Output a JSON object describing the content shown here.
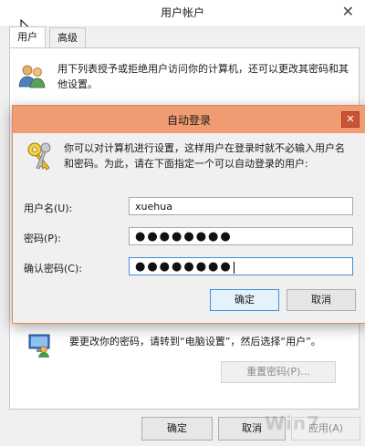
{
  "parent": {
    "title": "用户帐户",
    "tabs": [
      {
        "label": "用户",
        "active": true
      },
      {
        "label": "高级",
        "active": false
      }
    ],
    "description": "用下列表授予或拒绝用户访问你的计算机，还可以更改其密码和其他设置。",
    "password_hint": "要更改你的密码，请转到“电脑设置”，然后选择“用户”。",
    "reset_password_button": "重置密码(P)...",
    "buttons": {
      "ok": "确定",
      "cancel": "取消",
      "apply": "应用(A)"
    }
  },
  "dialog": {
    "title": "自动登录",
    "close_label": "✕",
    "description": "你可以对计算机进行设置，这样用户在登录时就不必输入用户名和密码。为此，请在下面指定一个可以自动登录的用户:",
    "fields": {
      "username": {
        "label": "用户名(U):",
        "value": "xuehua"
      },
      "password": {
        "label": "密码(P):",
        "value": "●●●●●●●●"
      },
      "confirm": {
        "label": "确认密码(C):",
        "value": "●●●●●●●●"
      }
    },
    "buttons": {
      "ok": "确定",
      "cancel": "取消"
    }
  },
  "watermark": "Win7",
  "colors": {
    "dialog_titlebar": "#f09c72",
    "dialog_close": "#c95435",
    "focus_border": "#3c8fdc"
  },
  "icons": [
    "users-icon",
    "keys-icon",
    "pc-user-icon",
    "close-icon",
    "mouse-cursor-icon"
  ]
}
